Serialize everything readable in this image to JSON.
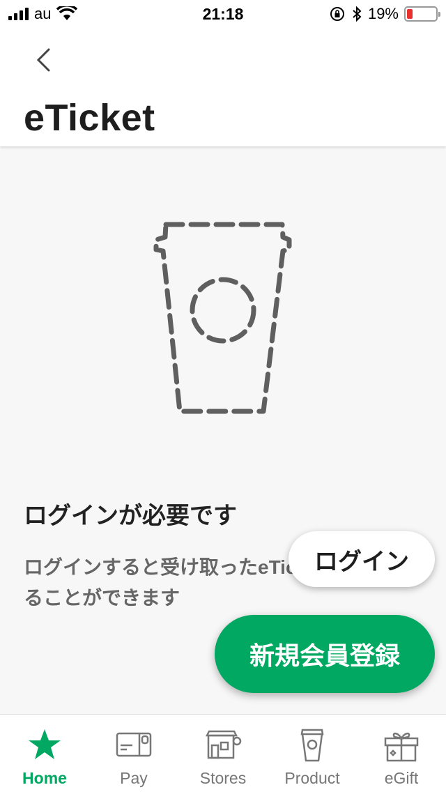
{
  "status_bar": {
    "carrier": "au",
    "time": "21:18",
    "battery_percent": "19%",
    "battery_level": 0.19,
    "battery_color": "#e8312f"
  },
  "header": {
    "back_icon": "chevron-left-icon",
    "title": "eTicket"
  },
  "illustration": {
    "icon": "cup-outline-icon"
  },
  "main": {
    "heading": "ログインが必要です",
    "description": "ログインすると受け取ったeTicketを確認することができます"
  },
  "buttons": {
    "login_label": "ログイン",
    "signup_label": "新規会員登録"
  },
  "tabs": [
    {
      "label": "Home",
      "icon": "star-icon",
      "active": true
    },
    {
      "label": "Pay",
      "icon": "card-icon",
      "active": false
    },
    {
      "label": "Stores",
      "icon": "store-icon",
      "active": false
    },
    {
      "label": "Product",
      "icon": "cup-icon",
      "active": false
    },
    {
      "label": "eGift",
      "icon": "gift-icon",
      "active": false
    }
  ],
  "colors": {
    "accent": "#00a862",
    "background": "#f7f7f7"
  }
}
